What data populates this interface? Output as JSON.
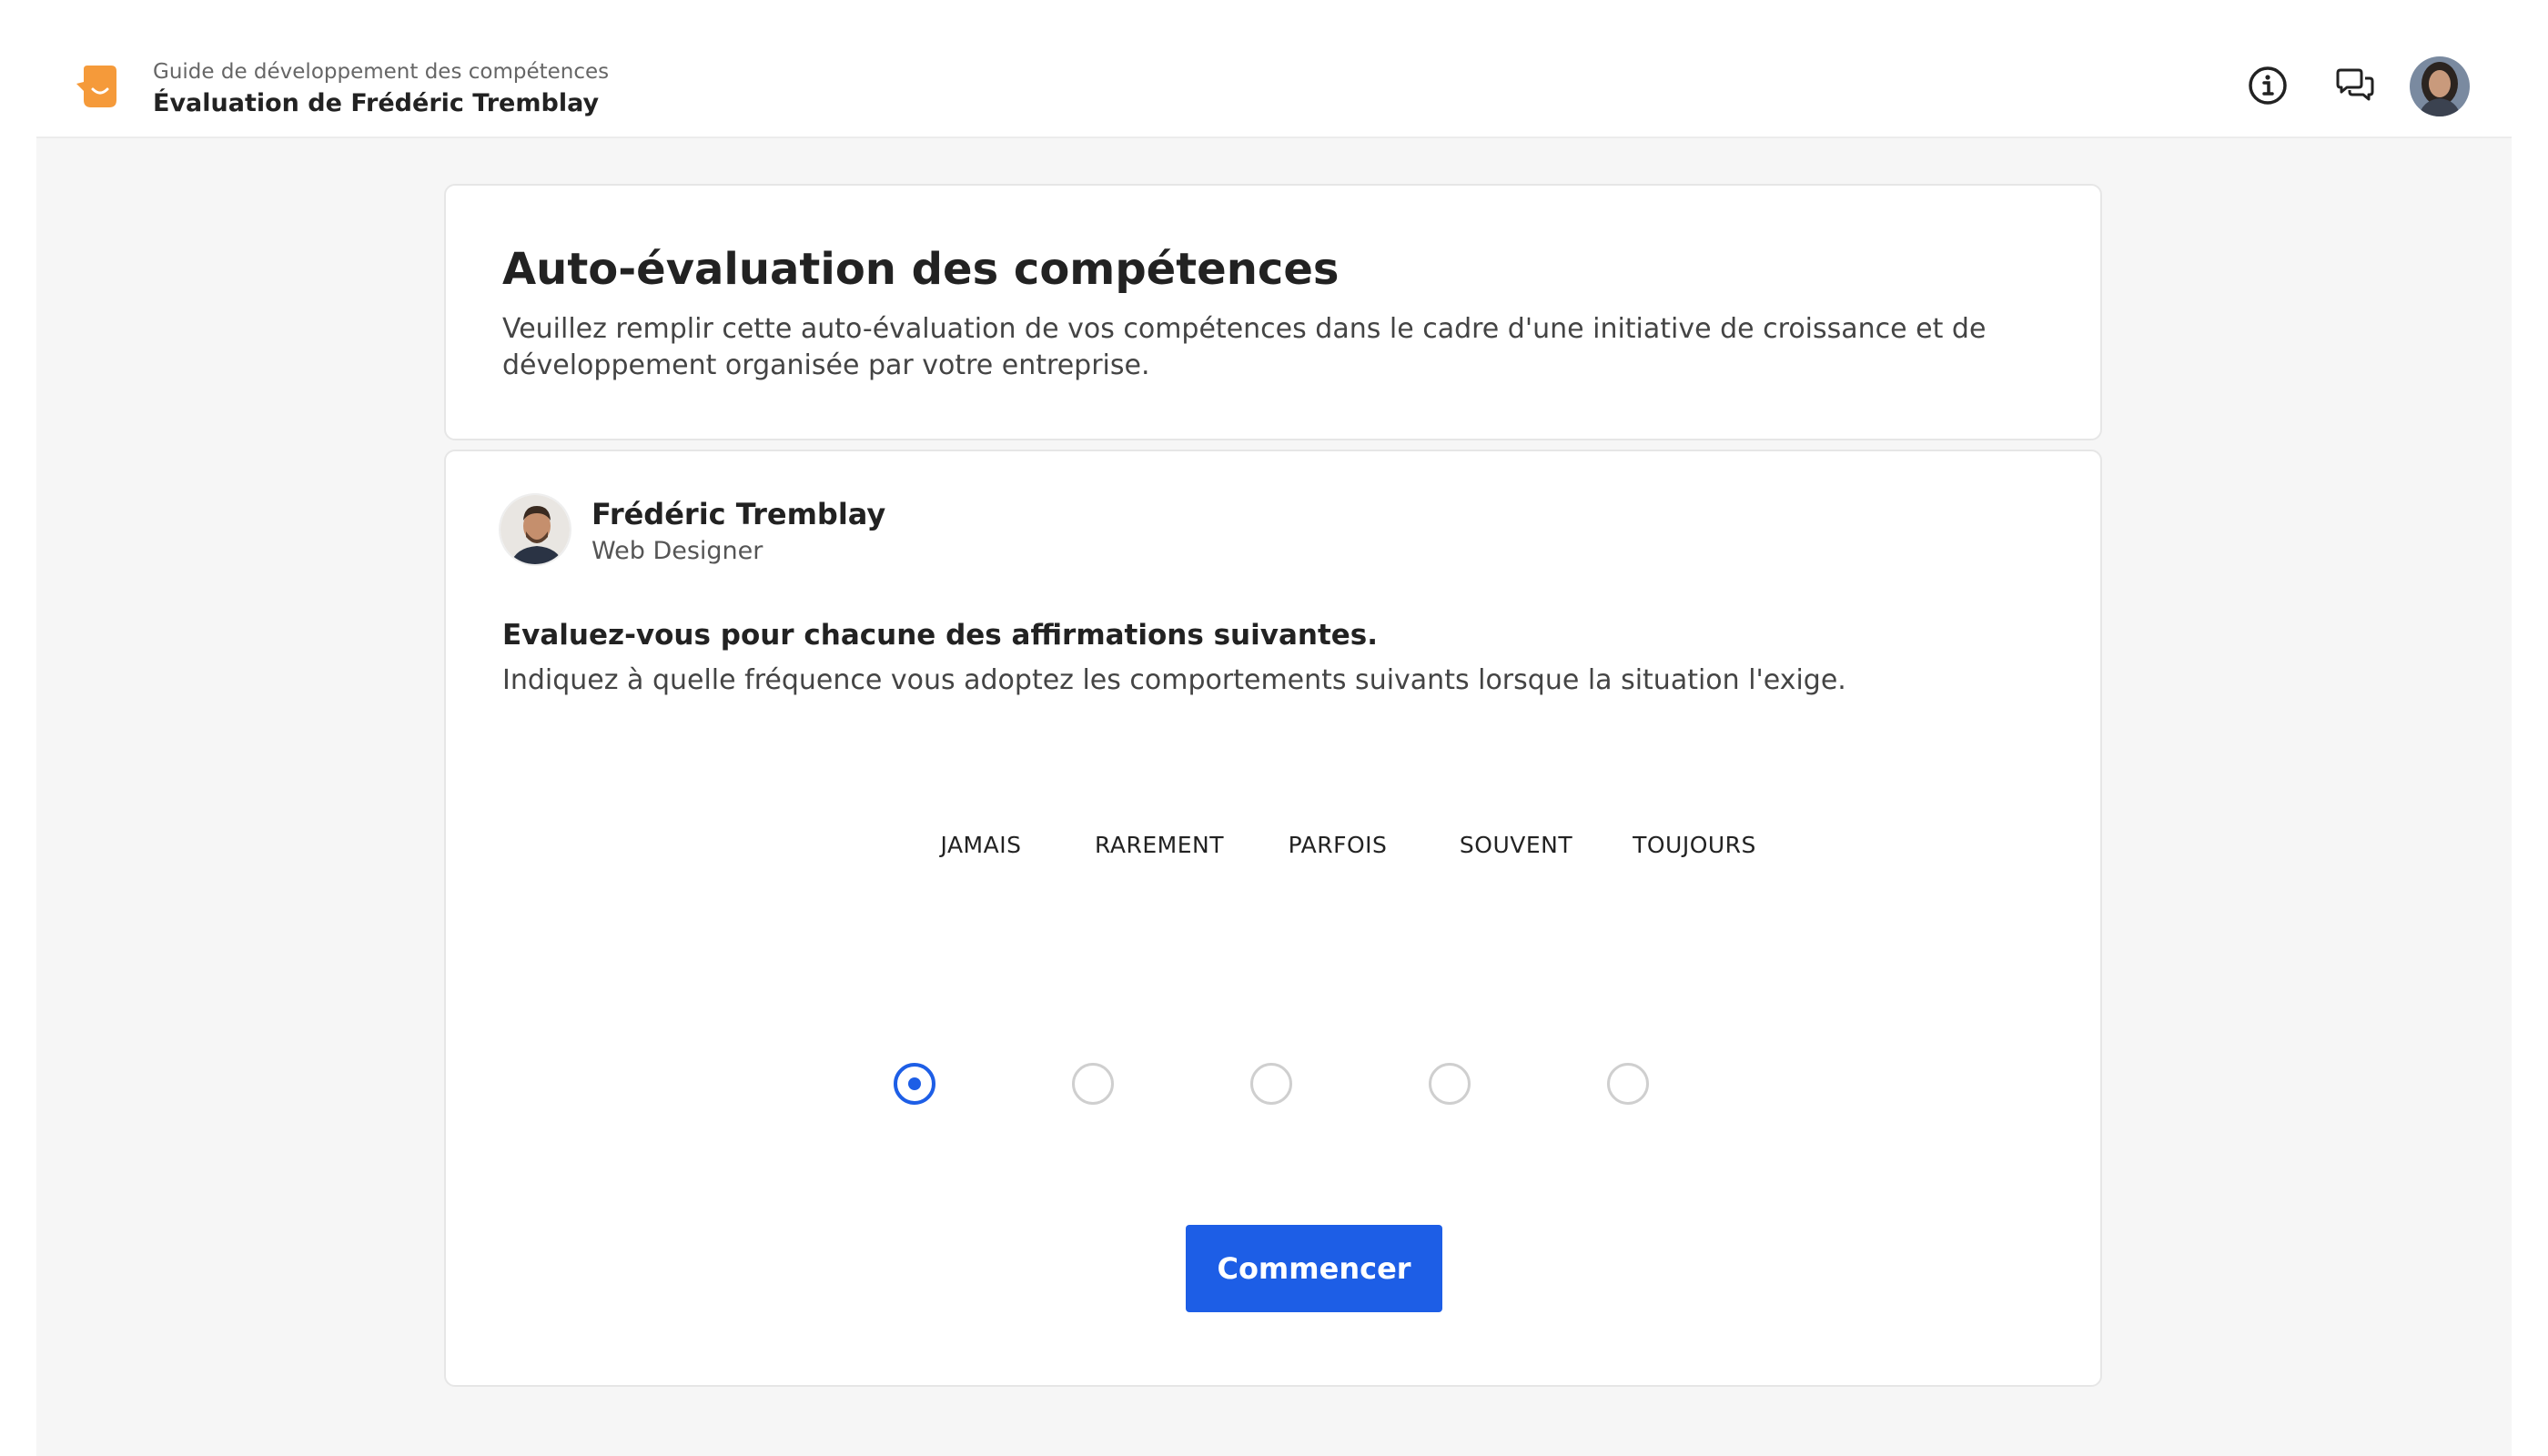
{
  "header": {
    "breadcrumb": "Guide de développement des compétences",
    "title": "Évaluation de Frédéric Tremblay",
    "icons": [
      "info-icon",
      "chat-icon",
      "user-avatar"
    ],
    "accent_color": "#F59A3A"
  },
  "intro": {
    "title": "Auto-évaluation des compétences",
    "description": "Veuillez remplir cette auto-évaluation de vos compétences dans le cadre d'une initiative de croissance et de développement organisée par votre entreprise."
  },
  "person": {
    "name": "Frédéric Tremblay",
    "role": "Web Designer"
  },
  "question": {
    "title": "Evaluez-vous pour chacune des affirmations suivantes.",
    "subtitle": "Indiquez à quelle fréquence vous adoptez les comportements suivants lorsque la situation l'exige."
  },
  "scale": {
    "options": [
      "JAMAIS",
      "RAREMENT",
      "PARFOIS",
      "SOUVENT",
      "TOUJOURS"
    ],
    "selected": "JAMAIS",
    "selected_color": "#1D5EE6"
  },
  "actions": {
    "start_label": "Commencer",
    "button_color": "#1D5EE6"
  }
}
